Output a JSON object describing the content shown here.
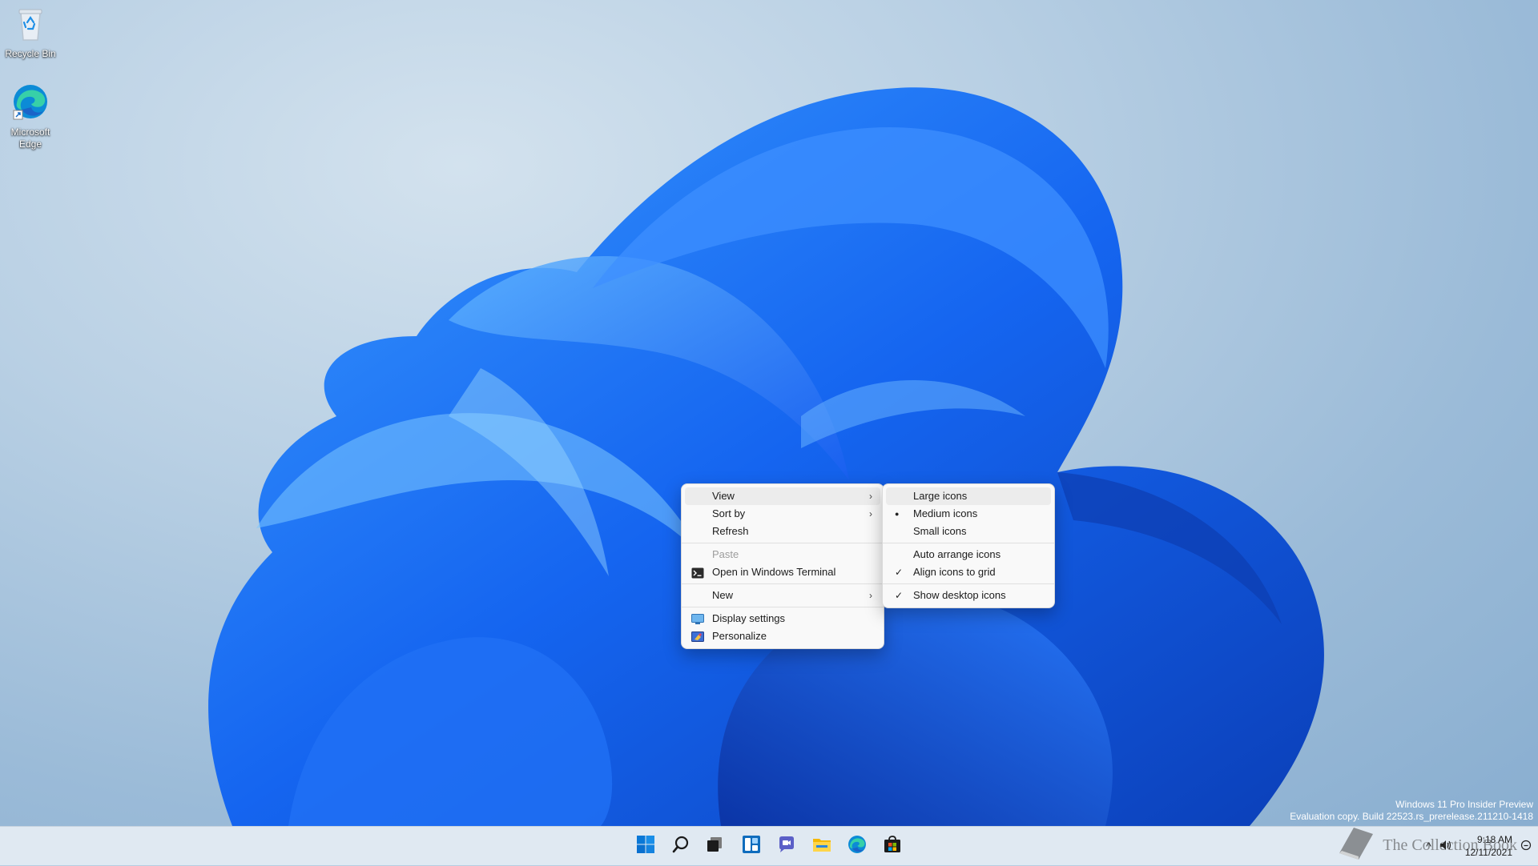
{
  "desktop": {
    "icons": [
      {
        "label": "Recycle Bin",
        "icon": "recycle-bin-icon"
      },
      {
        "label": "Microsoft Edge",
        "icon": "edge-icon"
      }
    ],
    "watermark": {
      "line1": "Windows 11 Pro Insider Preview",
      "line2": "Evaluation copy. Build 22523.rs_prerelease.211210-1418"
    }
  },
  "context_menu": {
    "items": [
      {
        "label": "View",
        "submenu": true
      },
      {
        "label": "Sort by",
        "submenu": true
      },
      {
        "label": "Refresh"
      },
      {
        "label": "Paste",
        "disabled": true
      },
      {
        "label": "Open in Windows Terminal",
        "icon": "terminal-icon"
      },
      {
        "label": "New",
        "submenu": true
      },
      {
        "label": "Display settings",
        "icon": "display-icon"
      },
      {
        "label": "Personalize",
        "icon": "personalize-icon"
      }
    ]
  },
  "view_submenu": {
    "items": [
      {
        "label": "Large icons"
      },
      {
        "label": "Medium icons",
        "mark": "bullet"
      },
      {
        "label": "Small icons"
      },
      {
        "label": "Auto arrange icons"
      },
      {
        "label": "Align icons to grid",
        "mark": "check"
      },
      {
        "label": "Show desktop icons",
        "mark": "check"
      }
    ]
  },
  "glyphs": {
    "chevron": "›",
    "check": "✓",
    "bullet": "●"
  },
  "taskbar": {
    "apps": [
      "start-icon",
      "search-icon",
      "task-view-icon",
      "widgets-icon",
      "chat-icon",
      "file-explorer-icon",
      "edge-icon",
      "store-icon"
    ],
    "tray": {
      "chevron": "^",
      "time": "9:18 AM",
      "date": "12/11/2021"
    },
    "brand": "The Collection Book"
  },
  "colors": {
    "accent": "#0067c0",
    "wallpaper_blue": "#1a5ff0",
    "menu_bg": "#f9f9f9"
  }
}
